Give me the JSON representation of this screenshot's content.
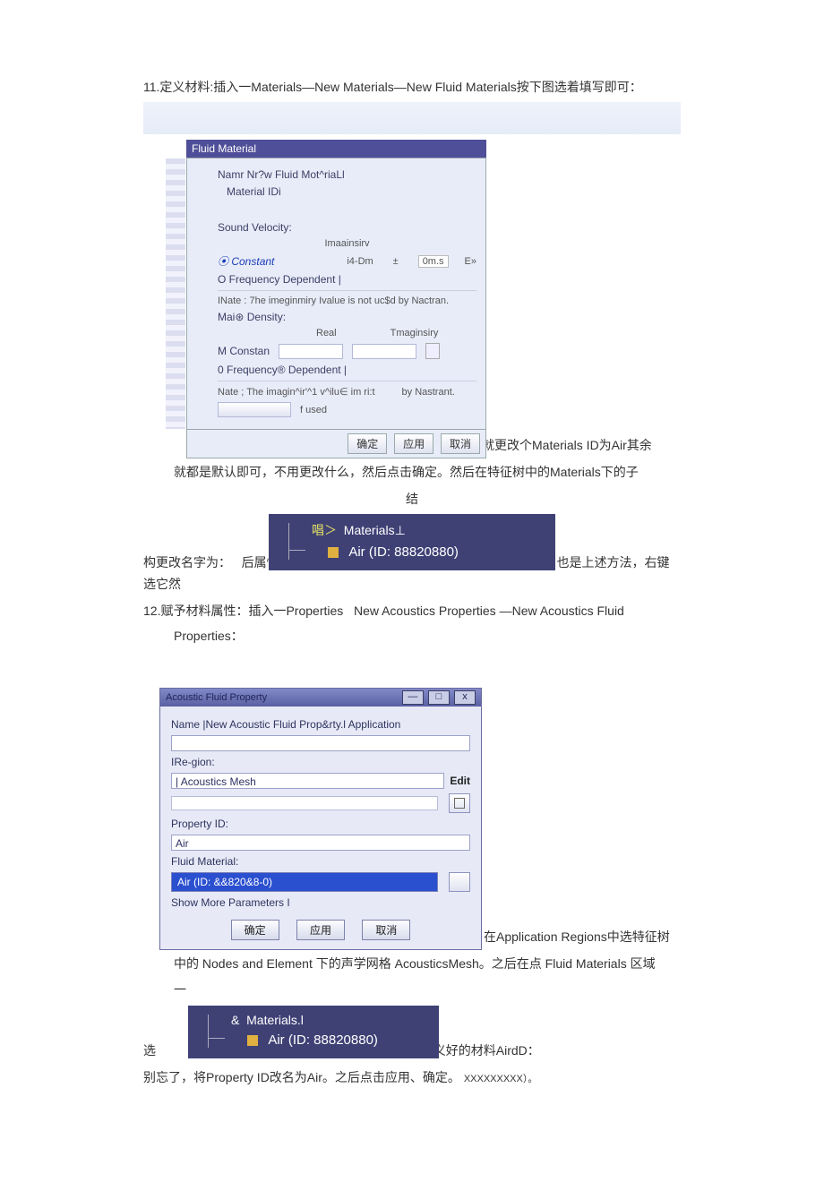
{
  "step11": {
    "heading": "11.定义材料:插入一Materials—New Materials—New Fluid Materials按下图选着填写即可：",
    "dialog": {
      "title": "Fluid Material",
      "name_label": "Namr Nr?w Fluid Mot^riaLl",
      "material_id_label": "Material IDi",
      "sound_velocity_label": "Sound Velocity:",
      "col_imag": "Imaainsirv",
      "constant_label": "Constant",
      "c4dm": "i4-Dm",
      "units": "0m.s",
      "eol": "E»",
      "freq_dep_label": "O Frequency Dependent |",
      "note1": "INate : 7he imeginmiry Ivalue is not uc$d by Nactran.",
      "mass_density_label": "Mai⊛ Density:",
      "col_real": "Real",
      "col_imag2": "Tmaginsiry",
      "m_constan": "M Constan",
      "freq_dep_label2": "0 Frequency® Dependent |",
      "note2_a": "Nate ; The imagin^ir'^1 v^ilu∈ im ri:t",
      "note2_b": "by Nastrant.",
      "used": "f used",
      "btn_ok": "确定",
      "btn_apply": "应用",
      "btn_cancel": "取消"
    },
    "after_dialog_right": "其实就更改个Materials ID为Air其余",
    "after_dialog_line2": "就都是默认即可，不用更改什么，然后点击确定。然后在特征树中的Materials下的子",
    "after_dialog_line3": "结",
    "tree": {
      "line1_pre": "唱＞",
      "line1_label": "Materials⊥",
      "line2": "Air (ID: 88820880)"
    },
    "final_left": "构更改名字为：",
    "final_mid": "后属性，特征",
    "final_right": "也是上述方法，右键选它然"
  },
  "step12": {
    "heading_a": "12.赋予材料属性：插入一Properties",
    "heading_b": "New Acoustics Properties",
    "heading_c": "—New Acoustics Fluid",
    "heading_d": "Properties：",
    "dialog": {
      "title": "Acoustic Fluid Property",
      "name_label": "Name |New Acoustic Fluid Prop&rty.l Application",
      "region_label": "IRe-gion:",
      "mesh_label": "| Acoustics Mesh",
      "edit": "Edit",
      "property_id_label": "Property ID:",
      "property_id_value": "Air",
      "fluid_material_label": "Fluid Material:",
      "fluid_material_value": "Air (ID: &&820&8-0)",
      "show_more": "Show More Parameters I",
      "btn_ok": "确定",
      "btn_apply": "应用",
      "btn_cancel": "取消"
    },
    "after_dialog_right": "在Application Regions中选特征树",
    "line2": "中的  Nodes and Element  下的声学网格  AcousticsMesh。之后在点  Fluid Materials 区域",
    "line3": "一",
    "tree": {
      "line1_pre": "&",
      "line1_label": "Materials.l",
      "line2": "Air (ID: 88820880)"
    },
    "bottom_left": "选",
    "bottom_right": "上边定义好的材料AirdD：",
    "bottom2_a": "别忘了，将Property ID改名为Air。之后点击应用、确定。",
    "bottom2_x": "XXXXXXXXX）。"
  }
}
